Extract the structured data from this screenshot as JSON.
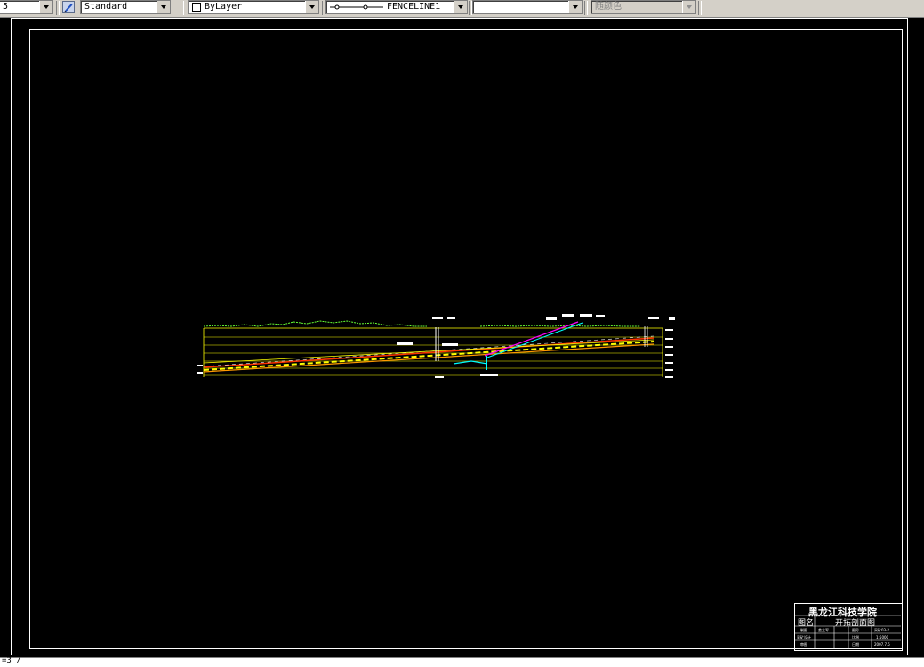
{
  "toolbar": {
    "first_combo_value": "5",
    "text_style": "Standard",
    "layer": "ByLayer",
    "linetype": "FENCELINE1",
    "lineweight": "",
    "color": "随颜色"
  },
  "title_block": {
    "school": "黑龙江科技学院",
    "name_label": "图名",
    "name_value": "开拓剖面图",
    "rows": [
      [
        "制图",
        "姜立军",
        "图号",
        "采矿03-2"
      ],
      [
        "采矿设计",
        "",
        "比例",
        "1:5000"
      ],
      [
        "审图",
        "",
        "日期",
        "2007.7.5"
      ]
    ]
  },
  "command_line": "=3 /",
  "colors": {
    "canvas": "#000000",
    "frame": "#ffffff",
    "section_lines": "#ffff00",
    "terrain": "#66ff33",
    "shaft": "#ff00ff",
    "roadway": "#00ffff",
    "coal_seam": "#ff3300"
  }
}
